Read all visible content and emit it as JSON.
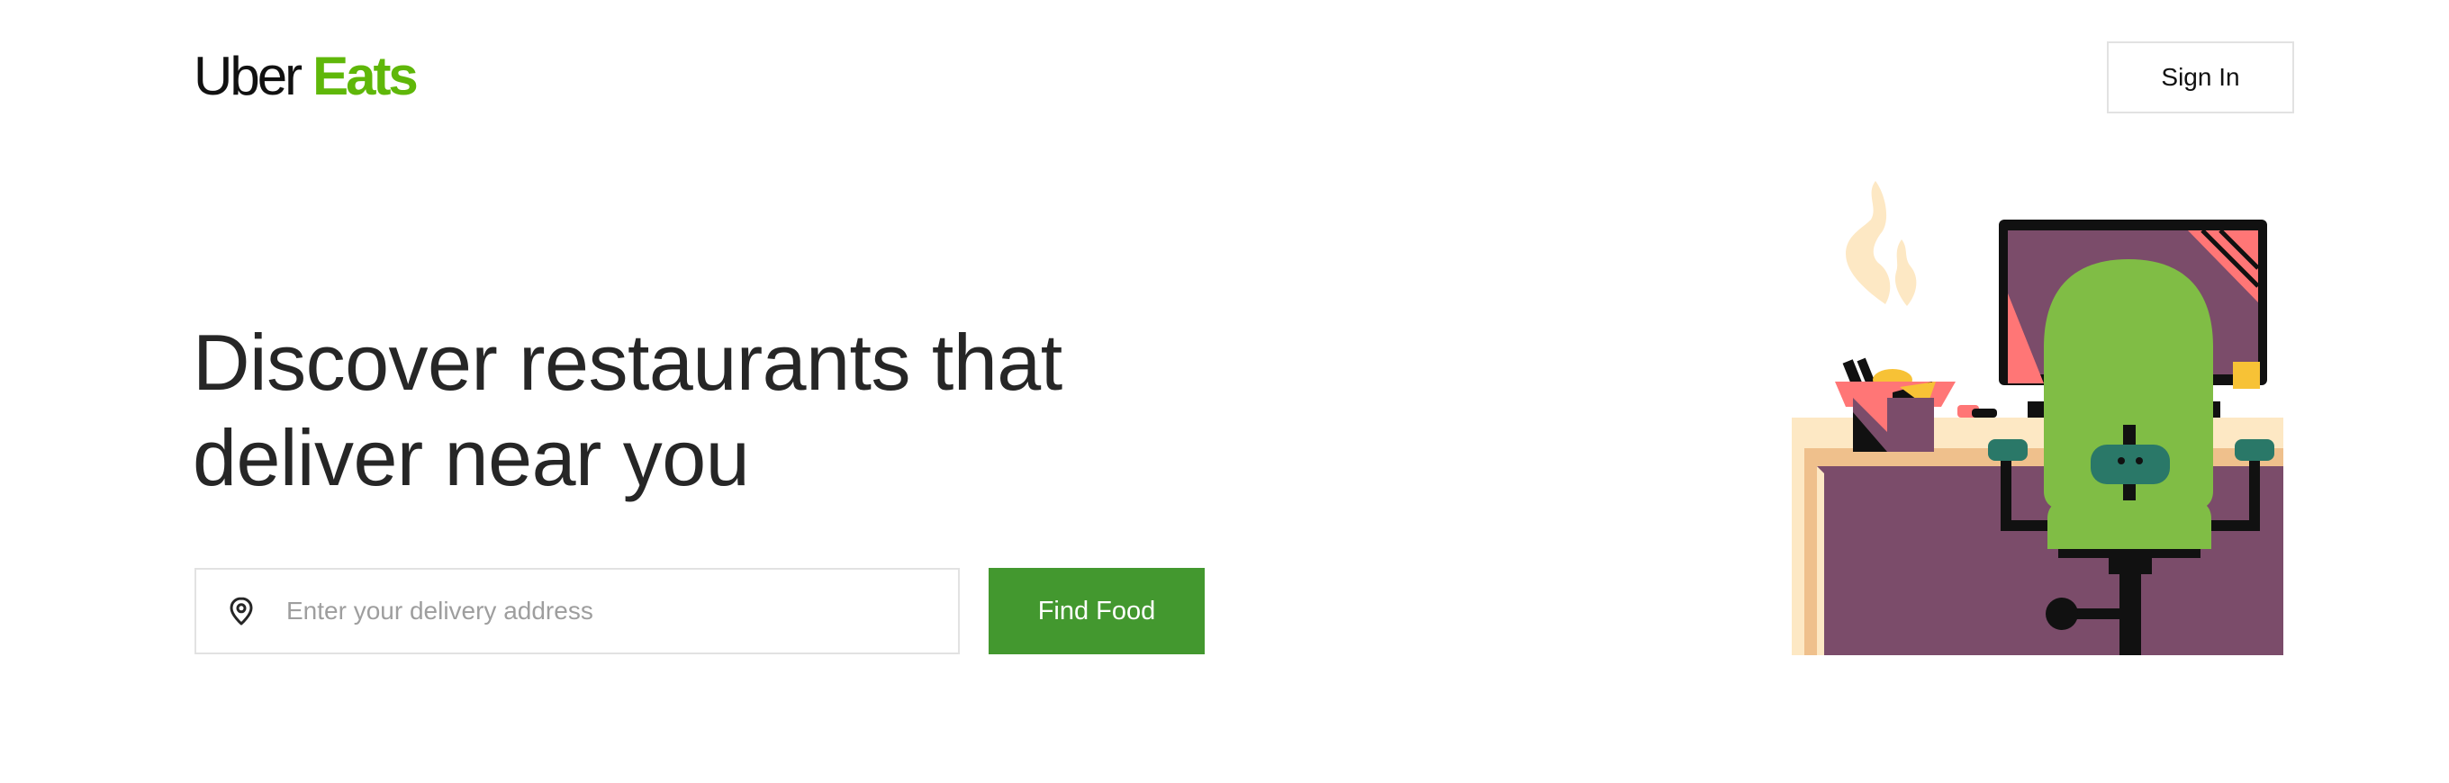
{
  "header": {
    "logo": {
      "part1": "Uber",
      "part2": "Eats"
    },
    "signin_label": "Sign In"
  },
  "hero": {
    "headline_line1": "Discover restaurants that",
    "headline_line2": "deliver near you",
    "address_placeholder": "Enter your delivery address",
    "address_value": "",
    "find_label": "Find Food",
    "pin_icon": "location-pin-icon",
    "illustration": "desk-with-chair-and-monitor"
  },
  "colors": {
    "brand_green": "#5fb709",
    "button_green": "#43982f",
    "text_dark": "#262626",
    "border_gray": "#e2e2e2",
    "placeholder_gray": "#9e9e9e"
  }
}
